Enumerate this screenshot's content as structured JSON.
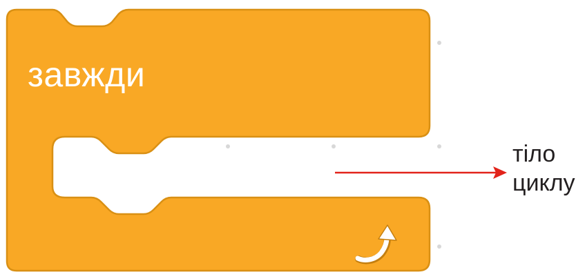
{
  "block": {
    "label": "завжди",
    "type": "forever-loop",
    "fill_color": "#F9A825",
    "border_color": "#D99014",
    "icon": "loop-arrow-icon"
  },
  "annotation": {
    "line1": "тіло",
    "line2": "циклу",
    "arrow_color": "#E2231A"
  }
}
